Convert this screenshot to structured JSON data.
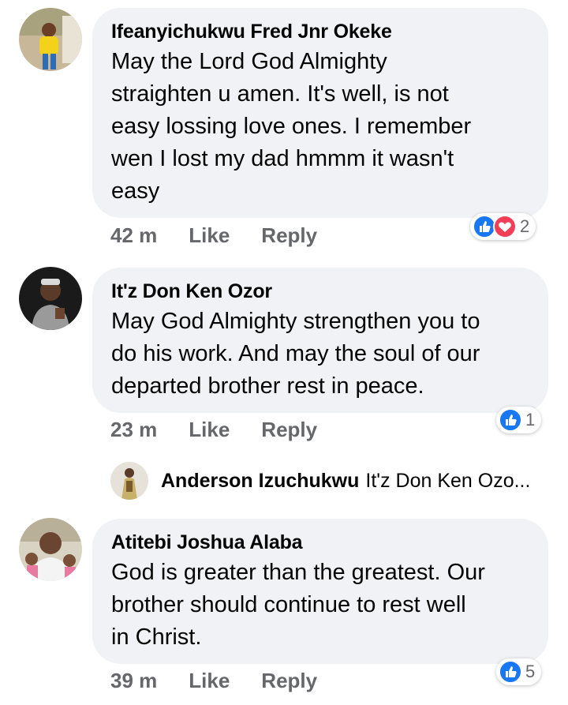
{
  "comments": [
    {
      "author": "Ifeanyichukwu Fred Jnr Okeke",
      "lines": [
        "May the Lord God Almighty",
        "straighten u amen. It's well, is not",
        "easy lossing love ones. I remember",
        "wen I lost my dad hmmm it wasn't",
        "easy"
      ],
      "time": "42 m",
      "like_label": "Like",
      "reply_label": "Reply",
      "reactions": [
        "like-icon",
        "love-icon"
      ],
      "reaction_count": "2"
    },
    {
      "author": "It'z Don Ken Ozor",
      "lines": [
        "May God Almighty strengthen you to",
        "do his work. And may the soul of our",
        "departed brother rest in peace."
      ],
      "time": "23 m",
      "like_label": "Like",
      "reply_label": "Reply",
      "reactions": [
        "like-icon"
      ],
      "reaction_count": "1"
    },
    {
      "author": "Atitebi Joshua Alaba",
      "lines": [
        "God is greater than the greatest. Our",
        "brother should continue to rest well",
        "in Christ."
      ],
      "time": "39 m",
      "like_label": "Like",
      "reply_label": "Reply",
      "reactions": [
        "like-icon"
      ],
      "reaction_count": "5"
    }
  ],
  "reply_preview": {
    "author": "Anderson Izuchukwu",
    "snippet": "It'z Don Ken Ozo..."
  },
  "colors": {
    "bubble": "#f0f2f5",
    "like_blue": "#1877f2",
    "love_red": "#f33e58",
    "meta_gray": "#65676b"
  }
}
